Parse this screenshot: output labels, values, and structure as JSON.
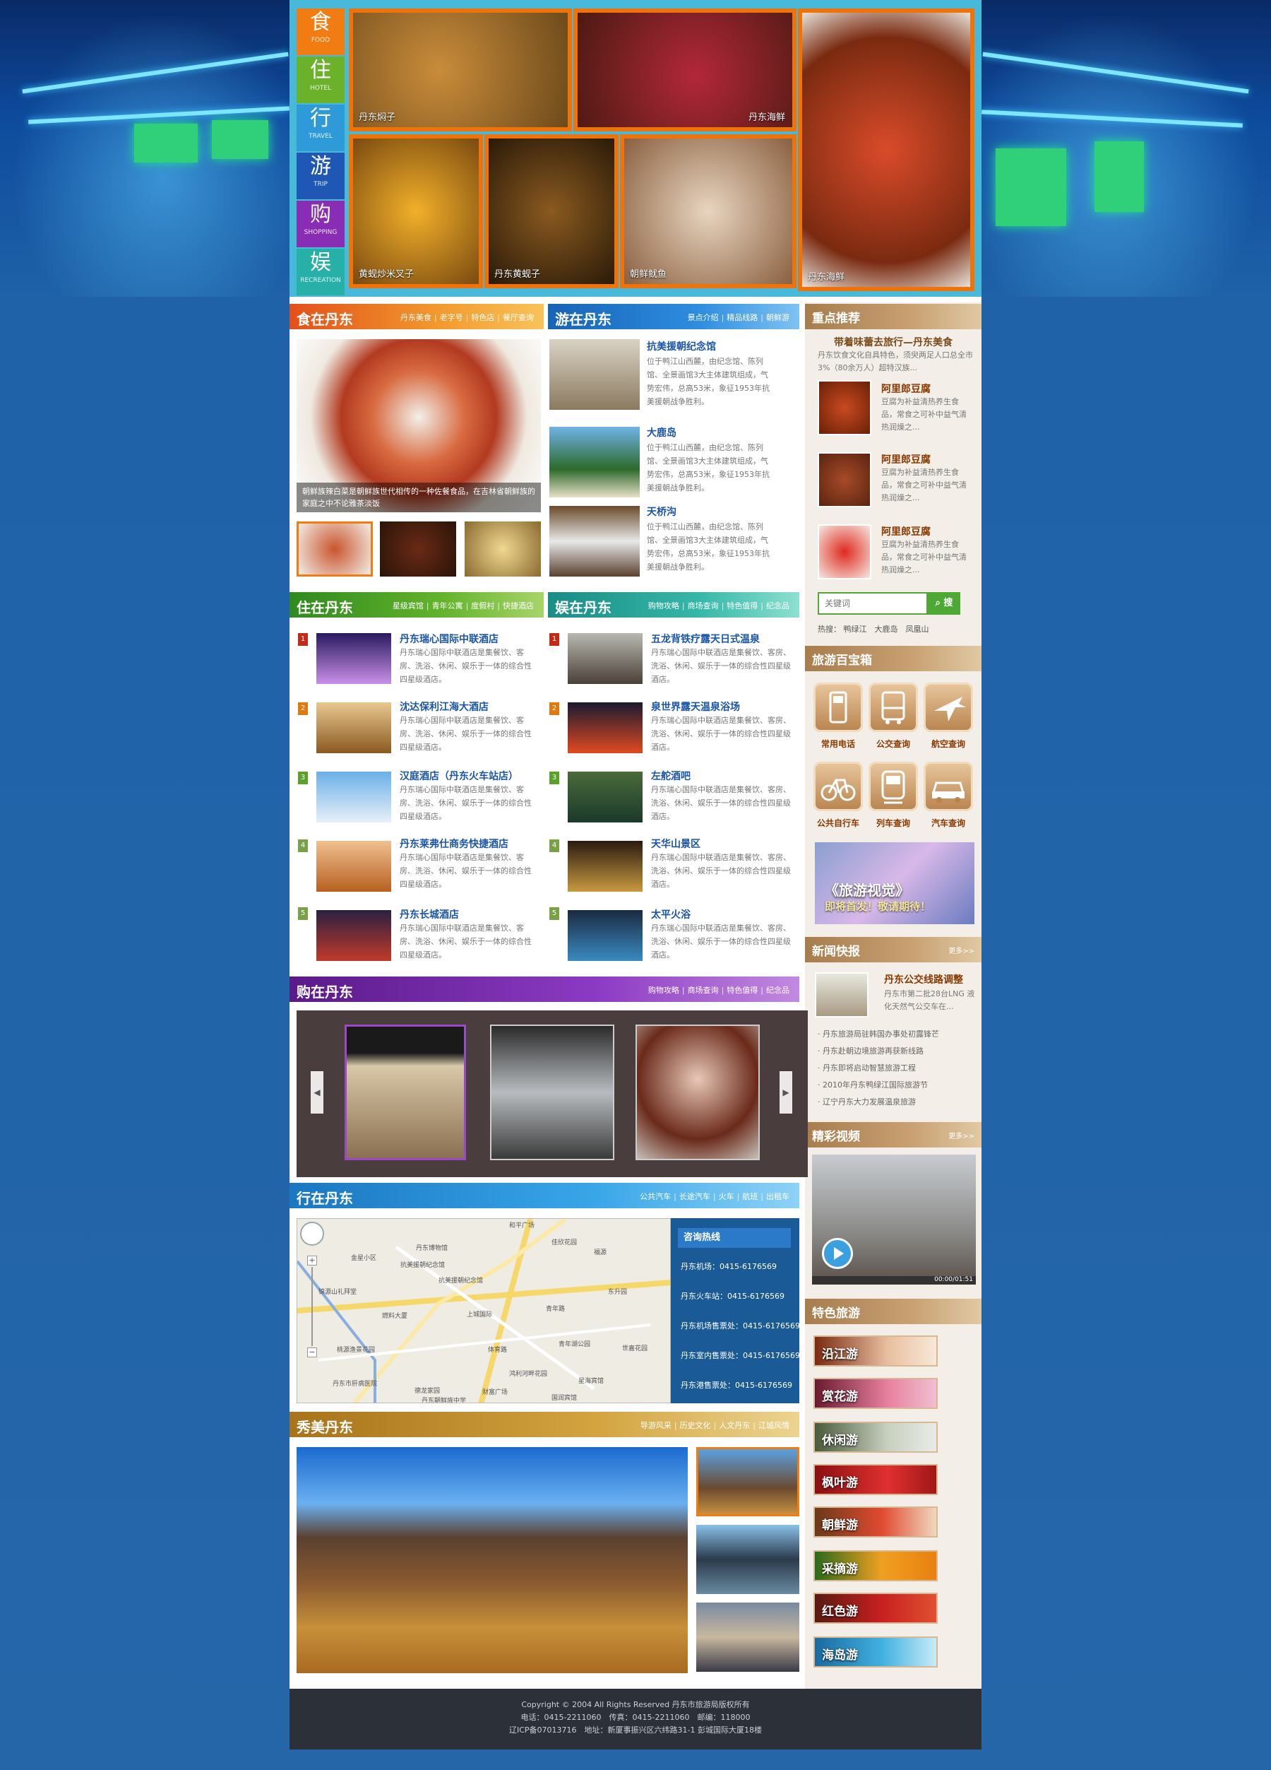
{
  "top_tabs": [
    {
      "char": "食",
      "en": "FOOD",
      "color": "#f07c12"
    },
    {
      "char": "住",
      "en": "HOTEL",
      "color": "#6cb12a"
    },
    {
      "char": "行",
      "en": "TRAVEL",
      "color": "#2f9ad8"
    },
    {
      "char": "游",
      "en": "TRIP",
      "color": "#1f58b4"
    },
    {
      "char": "购",
      "en": "SHOPPING",
      "color": "#8a2db5"
    },
    {
      "char": "娱",
      "en": "RECREATION",
      "color": "#27b0a8"
    }
  ],
  "top_foods": [
    "丹东焖子",
    "丹东海鲜",
    "丹东海鲜",
    "黄蚬炒米叉子",
    "丹东黄蚬子",
    "朝鲜鱿鱼",
    "丹东海鲜"
  ],
  "eat": {
    "title": "食在丹东",
    "links": [
      "丹东美食",
      "老字号",
      "特色店",
      "餐厅查询"
    ],
    "caption": "朝鲜族辣白菜是朝鲜族世代相传的一种佐餐食品，在吉林省朝鲜族的家庭之中不论雅茶淡饭"
  },
  "travel": {
    "title": "游在丹东",
    "links": [
      "景点介绍",
      "精品线路",
      "朝鲜游"
    ],
    "items": [
      {
        "title": "抗美援朝纪念馆",
        "desc": "位于鸭江山西麓，由纪念馆、陈列馆、全景画馆3大主体建筑组成，气势宏伟，总高53米，象征1953年抗美援朝战争胜利。"
      },
      {
        "title": "大鹿岛",
        "desc": "位于鸭江山西麓，由纪念馆、陈列馆、全景画馆3大主体建筑组成，气势宏伟，总高53米，象征1953年抗美援朝战争胜利。"
      },
      {
        "title": "天桥沟",
        "desc": "位于鸭江山西麓，由纪念馆、陈列馆、全景画馆3大主体建筑组成，气势宏伟，总高53米，象征1953年抗美援朝战争胜利。"
      }
    ]
  },
  "featured": {
    "title": "重点推荐",
    "headline": "带着味蕾去旅行—丹东美食",
    "intro": "丹东饮食文化自具特色，须臾两足人口总全市3%（80余万人）超特汉族...",
    "items": [
      {
        "title": "阿里郎豆腐",
        "desc": "豆腐为补益清热养生食品，常食之可补中益气清热润燥之..."
      },
      {
        "title": "阿里郎豆腐",
        "desc": "豆腐为补益清热养生食品，常食之可补中益气清热润燥之..."
      },
      {
        "title": "阿里郎豆腐",
        "desc": "豆腐为补益清热养生食品，常食之可补中益气清热润燥之..."
      }
    ]
  },
  "search": {
    "placeholder": "关键词",
    "button": "搜",
    "hot_label": "热搜：",
    "hot": [
      "鸭绿江",
      "大鹿岛",
      "凤凰山"
    ]
  },
  "toolbox": {
    "title": "旅游百宝箱",
    "items": [
      "常用电话",
      "公交查询",
      "航空查询",
      "公共自行车",
      "列车查询",
      "汽车查询"
    ]
  },
  "promo": {
    "line1": "《旅游视觉》",
    "line2": "即将首发！敬请期待！"
  },
  "stay": {
    "title": "住在丹东",
    "links": [
      "星级宾馆",
      "青年公寓",
      "度假村",
      "快捷酒店"
    ],
    "items": [
      {
        "title": "丹东瑞心国际中联酒店",
        "desc": "丹东瑞心国际中联酒店是集餐饮、客房、洗浴、休闲、娱乐于一体的综合性四星级酒店。"
      },
      {
        "title": "沈达保利江海大酒店",
        "desc": "丹东瑞心国际中联酒店是集餐饮、客房、洗浴、休闲、娱乐于一体的综合性四星级酒店。"
      },
      {
        "title": "汉庭酒店（丹东火车站店）",
        "desc": "丹东瑞心国际中联酒店是集餐饮、客房、洗浴、休闲、娱乐于一体的综合性四星级酒店。"
      },
      {
        "title": "丹东莱弗仕商务快捷酒店",
        "desc": "丹东瑞心国际中联酒店是集餐饮、客房、洗浴、休闲、娱乐于一体的综合性四星级酒店。"
      },
      {
        "title": "丹东长城酒店",
        "desc": "丹东瑞心国际中联酒店是集餐饮、客房、洗浴、休闲、娱乐于一体的综合性四星级酒店。"
      }
    ]
  },
  "fun": {
    "title": "娱在丹东",
    "links": [
      "购物攻略",
      "商场查询",
      "特色值得",
      "纪念品"
    ],
    "items": [
      {
        "title": "五龙背铁疗露天日式温泉",
        "desc": "丹东瑞心国际中联酒店是集餐饮、客房、洗浴、休闲、娱乐于一体的综合性四星级酒店。"
      },
      {
        "title": "泉世界露天温泉浴场",
        "desc": "丹东瑞心国际中联酒店是集餐饮、客房、洗浴、休闲、娱乐于一体的综合性四星级酒店。"
      },
      {
        "title": "左舵酒吧",
        "desc": "丹东瑞心国际中联酒店是集餐饮、客房、洗浴、休闲、娱乐于一体的综合性四星级酒店。"
      },
      {
        "title": "天华山景区",
        "desc": "丹东瑞心国际中联酒店是集餐饮、客房、洗浴、休闲、娱乐于一体的综合性四星级酒店。"
      },
      {
        "title": "太平火浴",
        "desc": "丹东瑞心国际中联酒店是集餐饮、客房、洗浴、休闲、娱乐于一体的综合性四星级酒店。"
      }
    ]
  },
  "news": {
    "title": "新闻快报",
    "more": "更多>>",
    "headline": "丹东公交线路调整",
    "lead": "丹东市第二批28台LNG 液化天然气公交车在...",
    "list": [
      "丹东旅游局驻韩国办事处初露锋芒",
      "丹东赴朝边境旅游再获新线路",
      "丹东即将启动智慧旅游工程",
      "2010年丹东鸭绿江国际旅游节",
      "辽宁丹东大力发展温泉旅游"
    ]
  },
  "shop": {
    "title": "购在丹东",
    "links": [
      "购物攻略",
      "商场查询",
      "特色值得",
      "纪念品"
    ]
  },
  "video": {
    "title": "精彩视频",
    "more": "更多>>",
    "time": "00:00/01:51"
  },
  "go": {
    "title": "行在丹东",
    "links": [
      "公共汽车",
      "长途汽车",
      "火车",
      "航班",
      "出租车"
    ],
    "map_labels": [
      "和平广场",
      "丹东博物馆",
      "抗美援朝纪念馆",
      "抗美援朝纪念馆",
      "金星小区",
      "锦源山礼拜堂",
      "燃料大厦",
      "上城国际",
      "桃源渔景花园",
      "丹东市肝病医院",
      "德龙家园",
      "丹东朝鲜族中学",
      "财富广场",
      "福源",
      "东升园",
      "青年湖公园",
      "世嘉花园",
      "鸿利河畔花园",
      "星海宾馆",
      "国润宾馆",
      "青年路",
      "佳欣花园",
      "体育路"
    ],
    "hotline_title": "咨询热线",
    "hotlines": [
      "丹东机场：0415-6176569",
      "丹东火车站：0415-6176569",
      "丹东机场售票处：0415-6176569",
      "丹东室内售票处：0415-6176569",
      "丹东港售票处：0415-6176569"
    ]
  },
  "special": {
    "title": "特色旅游",
    "items": [
      "沿江游",
      "赏花游",
      "休闲游",
      "枫叶游",
      "朝鲜游",
      "采摘游",
      "红色游",
      "海岛游"
    ]
  },
  "scenic": {
    "title": "秀美丹东",
    "links": [
      "导游风采",
      "历史文化",
      "人文丹东",
      "江城风情"
    ]
  },
  "footer": {
    "line1": "Copyright © 2004 All Rights Reserved 丹东市旅游局版权所有",
    "line2": "电话：0415-2211060　传真：0415-2211060　邮编：118000",
    "line3": "辽ICP备07013716　地址：新厦事振兴区六纬路31-1 彭城国际大厦18楼"
  }
}
